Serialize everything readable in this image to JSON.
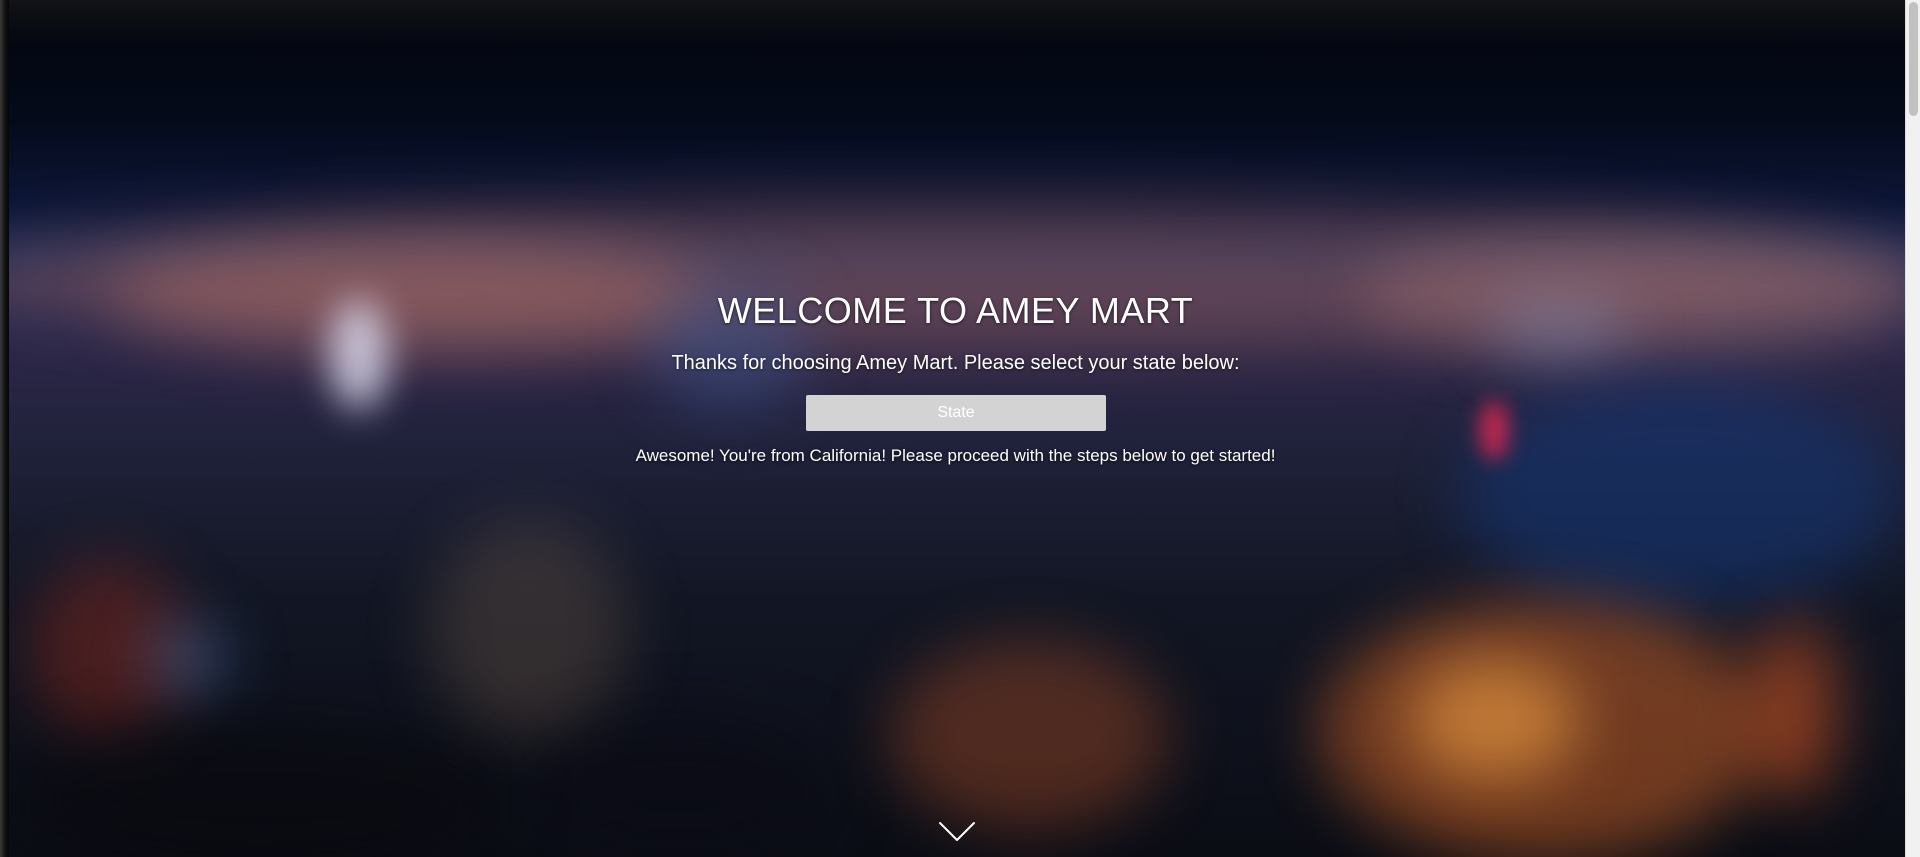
{
  "hero": {
    "title": "WELCOME TO AMEY MART",
    "subtitle": "Thanks for choosing Amey Mart. Please select your state below:",
    "state_select": {
      "selected_value": "State"
    },
    "message": "Awesome! You're from California! Please proceed with the steps below to get started!"
  },
  "icons": {
    "scroll_down": "chevron-down-icon"
  },
  "colors": {
    "text": "#ffffff",
    "select_background": "#d3d3d3"
  }
}
